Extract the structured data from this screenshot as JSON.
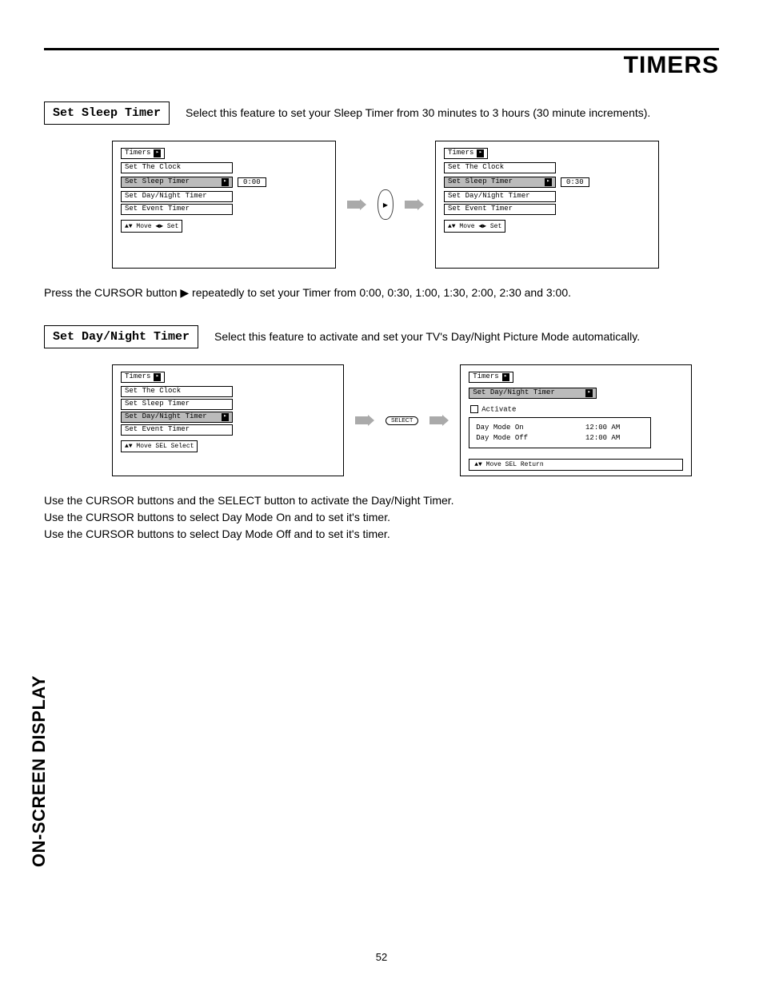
{
  "header": {
    "title": "TIMERS"
  },
  "sidebar_label": "ON-SCREEN DISPLAY",
  "page_number": "52",
  "section1": {
    "label": "Set Sleep Timer",
    "desc": "Select this feature to set your Sleep Timer from 30 minutes to 3 hours (30 minute increments).",
    "after_text": "Press the CURSOR button ▶ repeatedly to set your Timer from 0:00, 0:30, 1:00, 1:30, 2:00, 2:30 and 3:00."
  },
  "section2": {
    "label": "Set Day/Night Timer",
    "desc": "Select this feature to activate and set your TV's Day/Night Picture Mode automatically.",
    "after_text": "Use the CURSOR buttons and the SELECT button to activate the Day/Night Timer.\nUse the CURSOR buttons to select Day Mode On and to set it's timer.\nUse the CURSOR buttons to select Day Mode Off and to set it's timer."
  },
  "menus": {
    "title": "Timers",
    "items": {
      "clock": "Set The Clock",
      "sleep": "Set Sleep Timer",
      "daynight": "Set Day/Night Timer",
      "event": "Set Event Timer"
    },
    "hint_move_set": "▲▼ Move  ◀▶ Set",
    "hint_move_select": "▲▼ Move  SEL Select",
    "hint_move_return": "▲▼ Move   SEL Return",
    "val_000": "0:00",
    "val_030": "0:30"
  },
  "dn_panel": {
    "title": "Timers",
    "sub": "Set Day/Night Timer",
    "activate": "Activate",
    "on_label": "Day Mode On",
    "off_label": "Day Mode Off",
    "time": "12:00 AM"
  },
  "buttons": {
    "select": "SELECT"
  }
}
